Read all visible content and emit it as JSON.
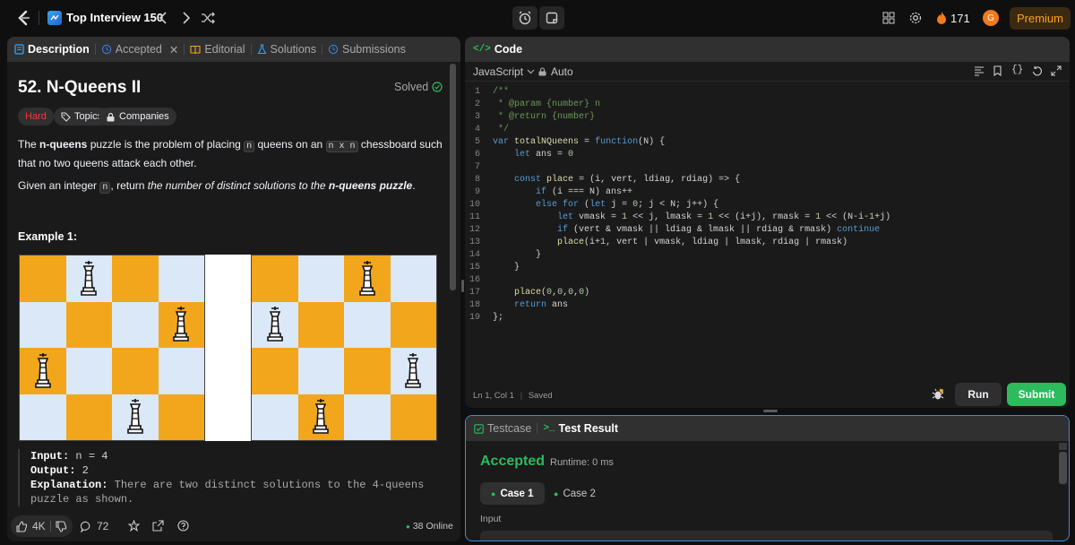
{
  "topbar": {
    "list_title": "Top Interview 150",
    "streak": "171",
    "avatar_letter": "G",
    "premium": "Premium"
  },
  "left_tabs": [
    {
      "label": "Description"
    },
    {
      "label": "Accepted"
    },
    {
      "label": "Editorial"
    },
    {
      "label": "Solutions"
    },
    {
      "label": "Submissions"
    }
  ],
  "problem": {
    "title": "52. N-Queens II",
    "solved": "Solved",
    "difficulty": "Hard",
    "topics": "Topics",
    "companies": "Companies",
    "desc1_a": "The ",
    "desc1_b": "n-queens",
    "desc1_c": " puzzle is the problem of placing ",
    "desc1_code1": "n",
    "desc1_d": " queens on an ",
    "desc1_code2": "n x n",
    "desc1_e": " chessboard such that no two queens attack each other.",
    "desc2_a": "Given an integer ",
    "desc2_code": "n",
    "desc2_b": ", return ",
    "desc2_em": "the number of distinct solutions to the ",
    "desc2_strong": "n-queens puzzle",
    "desc2_c": ".",
    "example_title": "Example 1:",
    "input_label": "Input:",
    "input_value": " n = 4",
    "output_label": "Output:",
    "output_value": " 2",
    "explanation_label": "Explanation:",
    "explanation_value": " There are two distinct solutions to the 4-queens puzzle as shown."
  },
  "left_footer": {
    "likes": "4K",
    "comments": "72",
    "online": "38 Online"
  },
  "code_panel": {
    "title": "Code",
    "language": "JavaScript",
    "mode": "Auto",
    "status_pos": "Ln 1, Col 1",
    "status_saved": "Saved",
    "run": "Run",
    "submit": "Submit"
  },
  "code_lines": [
    "/**",
    " * @param {number} n",
    " * @return {number}",
    " */",
    "var totalNQueens = function(N) {",
    "    let ans = 0",
    "",
    "    const place = (i, vert, ldiag, rdiag) => {",
    "        if (i === N) ans++",
    "        else for (let j = 0; j < N; j++) {",
    "            let vmask = 1 << j, lmask = 1 << (i+j), rmask = 1 << (N-i-1+j)",
    "            if (vert & vmask || ldiag & lmask || rdiag & rmask) continue",
    "            place(i+1, vert | vmask, ldiag | lmask, rdiag | rmask)",
    "        }",
    "    }",
    "",
    "    place(0,0,0,0)",
    "    return ans",
    "};"
  ],
  "result_panel": {
    "tab_testcase": "Testcase",
    "tab_result": "Test Result",
    "status": "Accepted",
    "runtime": "Runtime: 0 ms",
    "case1": "Case 1",
    "case2": "Case 2",
    "input_label": "Input"
  },
  "colors": {
    "accent_green": "#2cbb5d",
    "hard_red": "#f63737",
    "board_orange": "#f2a61c",
    "board_light": "#dae8f8"
  }
}
